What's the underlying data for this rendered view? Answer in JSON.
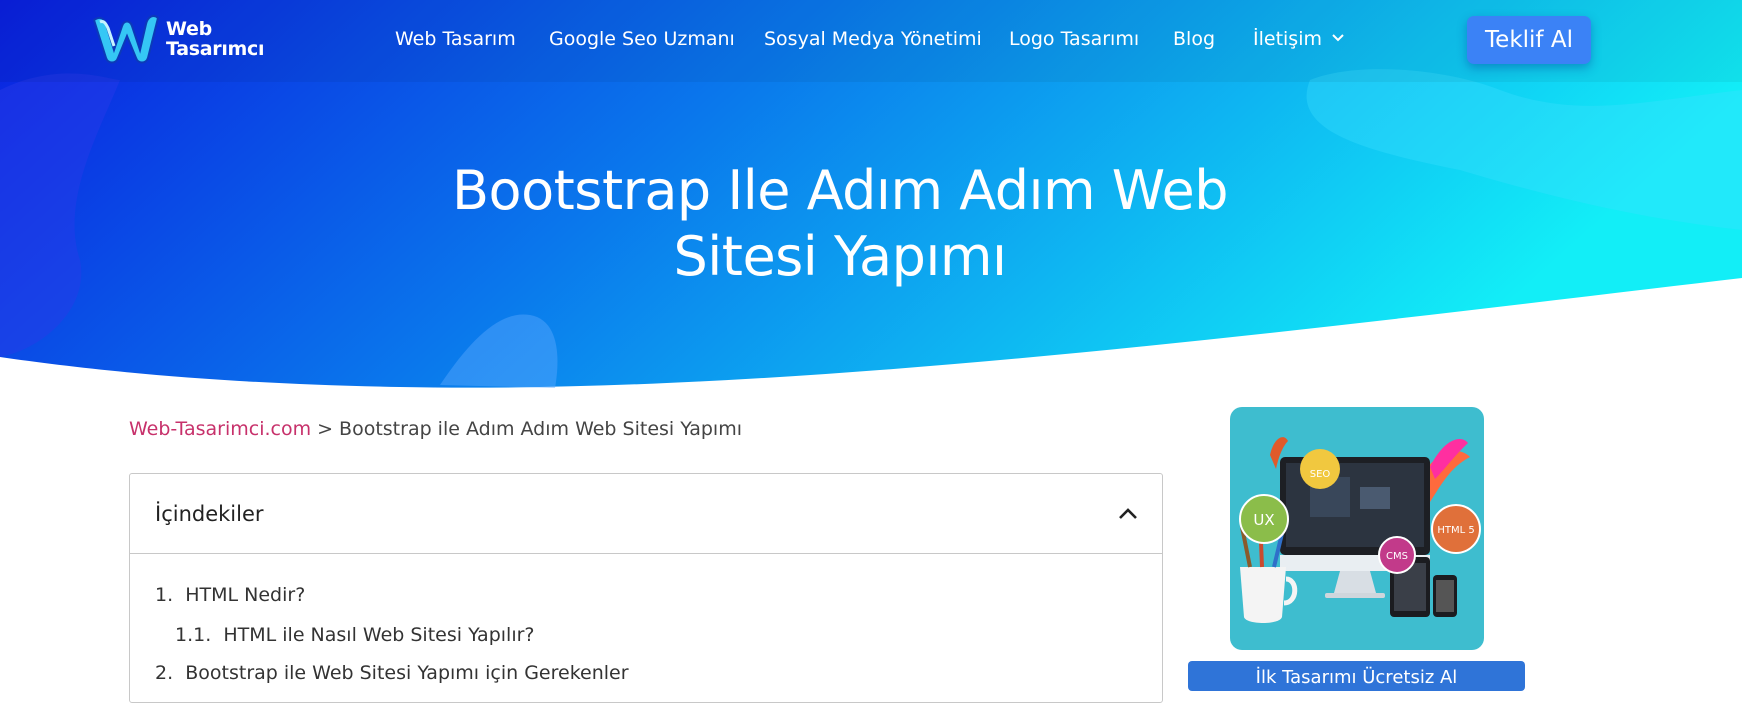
{
  "brand": {
    "line1": "Web",
    "line2": "Tasarımcı"
  },
  "nav": {
    "items": [
      {
        "label": "Web Tasarım"
      },
      {
        "label": "Google Seo Uzmanı"
      },
      {
        "label": "Sosyal Medya Yönetimi"
      },
      {
        "label": "Logo Tasarımı"
      },
      {
        "label": "Blog"
      },
      {
        "label": "İletişim"
      }
    ],
    "cta": "Teklif Al"
  },
  "hero": {
    "title_line1": "Bootstrap Ile Adım Adım Web",
    "title_line2": "Sitesi Yapımı"
  },
  "breadcrumb": {
    "home": "Web-Tasarimci.com",
    "separator": ">",
    "current": "Bootstrap ile Adım Adım Web Sitesi Yapımı"
  },
  "toc": {
    "title": "İçindekiler",
    "items": [
      {
        "num": "1.",
        "label": "HTML Nedir?"
      },
      {
        "num": "1.1.",
        "label": "HTML ile Nasıl Web Sitesi Yapılır?"
      },
      {
        "num": "2.",
        "label": "Bootstrap ile Web Sitesi Yapımı için Gerekenler"
      }
    ]
  },
  "sidebar": {
    "badges": {
      "seo": "SEO",
      "ux": "UX",
      "html5": "HTML 5",
      "cms": "CMS"
    },
    "button": "İlk Tasarımı Ücretsiz Al"
  },
  "colors": {
    "hero_start": "#0a2fe0",
    "hero_end": "#12e8f5",
    "accent_link": "#c7316b",
    "cta": "#3b82f6"
  }
}
